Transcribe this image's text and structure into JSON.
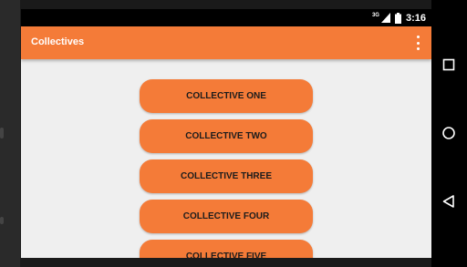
{
  "status_bar": {
    "network_type": "3G",
    "time": "3:16"
  },
  "app_bar": {
    "title": "Collectives",
    "menu_icon": "overflow-menu-icon"
  },
  "collectives": [
    {
      "label": "COLLECTIVE ONE"
    },
    {
      "label": "COLLECTIVE TWO"
    },
    {
      "label": "COLLECTIVE THREE"
    },
    {
      "label": "COLLECTIVE FOUR"
    },
    {
      "label": "COLLECTIVE FIVE"
    }
  ],
  "navigation": {
    "recents_icon": "square-icon",
    "home_icon": "circle-icon",
    "back_icon": "triangle-back-icon"
  },
  "colors": {
    "accent": "#f47b38",
    "background": "#efefef",
    "button_text": "#1c1c1c"
  }
}
